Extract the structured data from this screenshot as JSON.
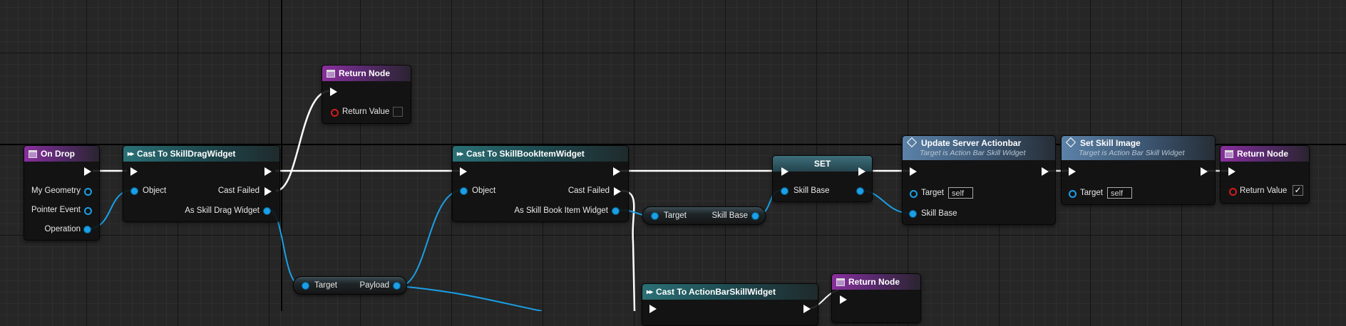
{
  "graph": {
    "nodes": {
      "return_node_top": {
        "title": "Return Node",
        "return_value_label": "Return Value"
      },
      "on_drop": {
        "title": "On Drop",
        "pins": [
          "My Geometry",
          "Pointer Event",
          "Operation"
        ]
      },
      "cast_skill_drag": {
        "title": "Cast To SkillDragWidget",
        "object_label": "Object",
        "cast_failed_label": "Cast Failed",
        "output_label": "As Skill Drag Widget"
      },
      "payload_getter": {
        "target_label": "Target",
        "output_label": "Payload"
      },
      "cast_skill_book": {
        "title": "Cast To SkillBookItemWidget",
        "object_label": "Object",
        "cast_failed_label": "Cast Failed",
        "output_label": "As Skill Book Item Widget"
      },
      "skill_base_getter": {
        "target_label": "Target",
        "output_label": "Skill Base"
      },
      "set_node": {
        "title": "SET",
        "input_label": "Skill Base"
      },
      "update_server_actionbar": {
        "title": "Update Server Actionbar",
        "subtitle": "Target is Action Bar Skill Widget",
        "target_label": "Target",
        "target_value": "self",
        "skill_base_label": "Skill Base"
      },
      "set_skill_image": {
        "title": "Set Skill Image",
        "subtitle": "Target is Action Bar Skill Widget",
        "target_label": "Target",
        "target_value": "self"
      },
      "return_node_right": {
        "title": "Return Node",
        "return_value_label": "Return Value",
        "return_value_checked": true
      },
      "cast_actionbar": {
        "title": "Cast To ActionBarSkillWidget"
      },
      "return_node_bottom": {
        "title": "Return Node"
      }
    },
    "colors": {
      "background": "#262626",
      "exec_wire": "#ffffff",
      "object_wire": "#1aa0e6",
      "function_header": "#8a2f9e",
      "cast_header": "#2a7076",
      "target_function_header": "#5c82a8"
    }
  }
}
